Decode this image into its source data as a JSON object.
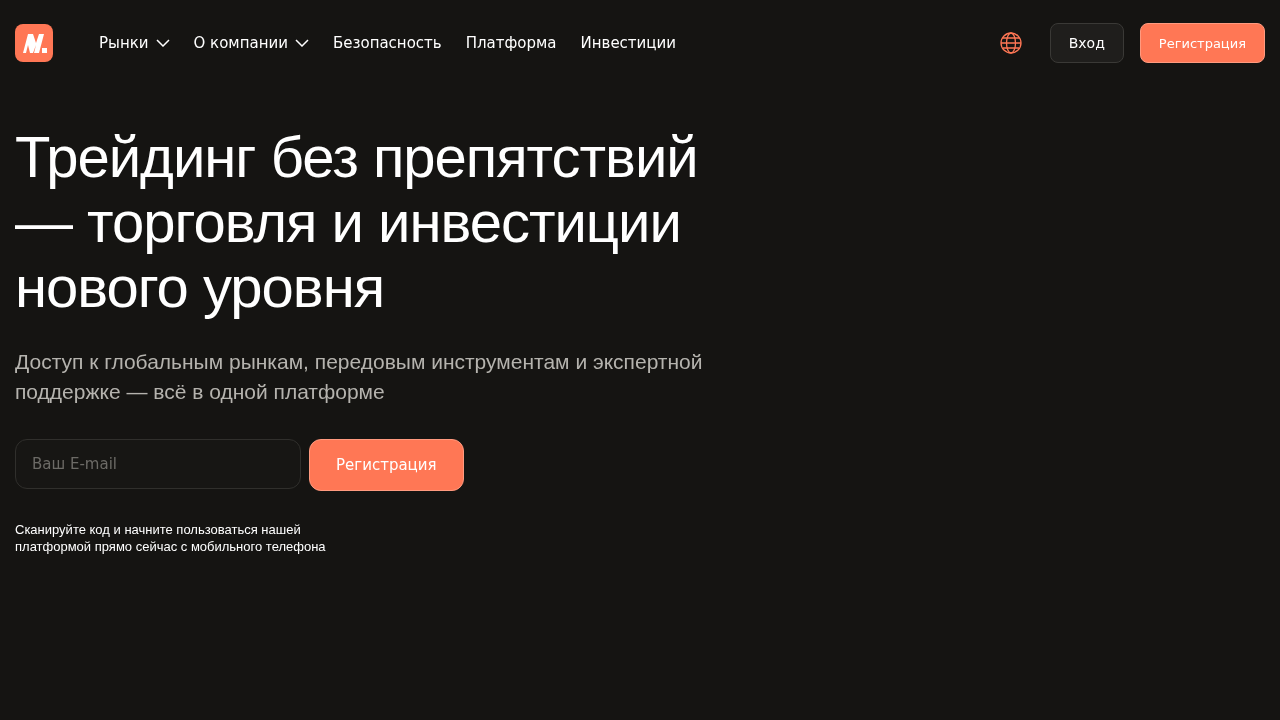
{
  "header": {
    "nav": [
      {
        "label": "Рынки",
        "kind": "dropdown"
      },
      {
        "label": "О компании",
        "kind": "dropdown"
      },
      {
        "label": "Безопасность",
        "kind": "link"
      },
      {
        "label": "Платформа",
        "kind": "link"
      },
      {
        "label": "Инвестиции",
        "kind": "link"
      }
    ],
    "login": "Вход",
    "register": "Регистрация"
  },
  "hero": {
    "title_lines": [
      "Трейдинг без препятствий",
      "— торговля и инвестиции",
      "нового уровня"
    ],
    "subtitle": "Доступ к глобальным рынкам, передовым инструментам и экспертной поддержке — всё в одной платформе",
    "email": {
      "placeholder": "Ваш E-mail"
    },
    "register": "Регистрация",
    "note": "Сканируйте код и начните пользоваться нашей платформой прямо сейчас с мобильного телефона"
  }
}
